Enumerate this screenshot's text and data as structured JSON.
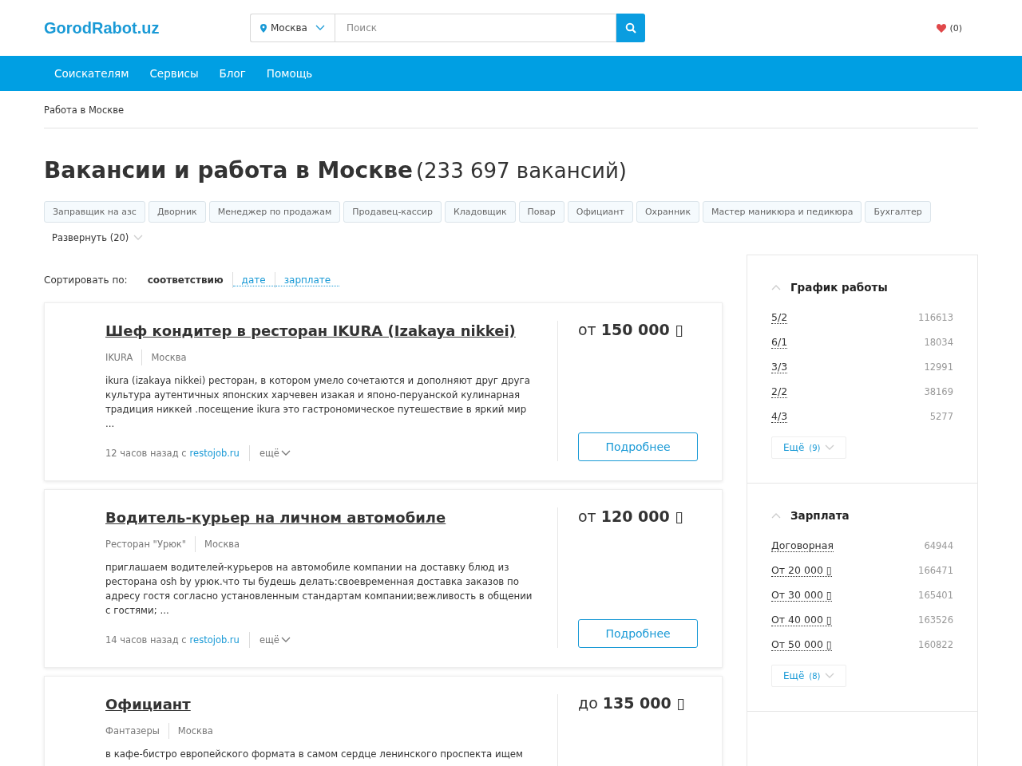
{
  "header": {
    "logo": "GorodRabot.uz",
    "city": "Москва",
    "search": {
      "placeholder": "Поиск"
    },
    "favorites": "(0)"
  },
  "nav": [
    "Соискателям",
    "Сервисы",
    "Блог",
    "Помощь"
  ],
  "breadcrumb": "Работа в Москве",
  "page_title": {
    "title": "Вакансии и работа в Москве",
    "count": "(233 697 вакансий)"
  },
  "tags": [
    "Заправщик на азс",
    "Дворник",
    "Менеджер по продажам",
    "Продавец-кассир",
    "Кладовщик",
    "Повар",
    "Официант",
    "Охранник",
    "Мастер маникюра и педикюра",
    "Бухгалтер"
  ],
  "expand": {
    "label": "Развернуть (20)",
    "expanded": false
  },
  "sort": {
    "label": "Сортировать по:",
    "options": [
      {
        "label": "соответствию",
        "selected": true
      },
      {
        "label": "дате",
        "selected": false
      },
      {
        "label": "зарплате",
        "selected": false
      }
    ]
  },
  "jobs": [
    {
      "title": "Шеф кондитер в ресторан IKURA (Izakaya nikkei)",
      "company": "IKURA",
      "city": "Москва",
      "description": "ikura (izakaya nikkei) ресторан, в котором умело сочетаются и дополняют друг друга культура аутентичных японских харчевен изакая и японо-перуанской кулинарная традиция никкей .посещение ikura это гастрономическое путешествие в яркий мир ...",
      "time": "12 часов назад с",
      "source": "restojob.ru",
      "more": "ещё",
      "salary_prefix": "от",
      "salary": "150 000 ▯",
      "button": "Подробнее"
    },
    {
      "title": "Водитель-курьер на личном автомобиле",
      "company": "Ресторан \"Урюк\"",
      "city": "Москва",
      "description": "приглашаем водителей-курьеров на автомобиле компании на доставку блюд из ресторана osh by урюк.что ты будешь делать:своевременная доставка заказов по адресу гостя согласно установленным стандартам компании;вежливость в общении с гостями; ...",
      "time": "14 часов назад с",
      "source": "restojob.ru",
      "more": "ещё",
      "salary_prefix": "от",
      "salary": "120 000 ▯",
      "button": "Подробнее"
    },
    {
      "title": "Официант",
      "company": "Фантазеры",
      "city": "Москва",
      "description": "в кафе-бистро европейского формата в самом сердце ленинского проспекта ищем",
      "salary_prefix": "до",
      "salary": "135 000 ▯"
    }
  ],
  "filters": [
    {
      "title": "График работы",
      "expanded": true,
      "items": [
        {
          "label": "5/2",
          "count": "116613"
        },
        {
          "label": "6/1",
          "count": "18034"
        },
        {
          "label": "3/3",
          "count": "12991"
        },
        {
          "label": "2/2",
          "count": "38169"
        },
        {
          "label": "4/3",
          "count": "5277"
        }
      ],
      "more": {
        "label": "Ещё",
        "count": "(9)"
      }
    },
    {
      "title": "Зарплата",
      "expanded": true,
      "items": [
        {
          "label": "Договорная",
          "count": "64944"
        },
        {
          "label": "От 20 000 ▯",
          "count": "166471"
        },
        {
          "label": "От 30 000 ▯",
          "count": "165401"
        },
        {
          "label": "От 40 000 ▯",
          "count": "163526"
        },
        {
          "label": "От 50 000 ▯",
          "count": "160822"
        }
      ],
      "more": {
        "label": "Ещё",
        "count": "(8)"
      }
    }
  ]
}
